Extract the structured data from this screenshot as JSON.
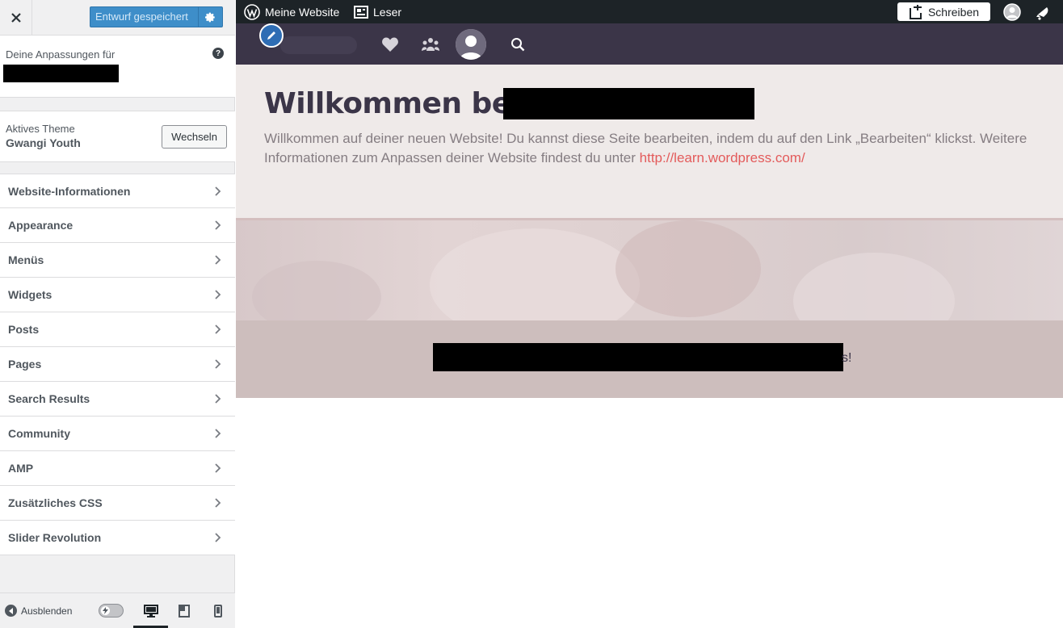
{
  "sidebar": {
    "close_label": "×",
    "save_label": "Entwurf gespeichert",
    "info_label": "Deine Anpassungen für",
    "help_label": "?",
    "theme": {
      "label": "Aktives Theme",
      "name": "Gwangi Youth",
      "change_label": "Wechseln"
    },
    "panels": [
      {
        "label": "Website-Informationen"
      },
      {
        "label": "Appearance"
      },
      {
        "label": "Menüs"
      },
      {
        "label": "Widgets"
      },
      {
        "label": "Posts"
      },
      {
        "label": "Pages"
      },
      {
        "label": "Search Results"
      },
      {
        "label": "Community"
      },
      {
        "label": "AMP"
      },
      {
        "label": "Zusätzliches CSS"
      },
      {
        "label": "Slider Revolution"
      }
    ],
    "footer": {
      "collapse_label": "Ausblenden",
      "active_device": "desktop"
    }
  },
  "adminbar": {
    "site_label": "Meine Website",
    "reader_label": "Leser",
    "write_label": "Schreiben"
  },
  "preview": {
    "hero_title": "Willkommen bei",
    "hero_text": "Willkommen auf deiner neuen Website! Du kannst diese Seite bearbeiten, indem du auf den Link „Bearbeiten“ klickst. Weitere Informationen zum Anpassen deiner Website findest du unter ",
    "hero_link": "http://learn.wordpress.com/",
    "band_tail": "s!"
  },
  "colors": {
    "primary_button": "#3e8ec9",
    "admin_bar": "#1d2327",
    "theme_nav": "#3b3548",
    "link": "#e35b5b",
    "hero_bg": "#efeae9"
  }
}
